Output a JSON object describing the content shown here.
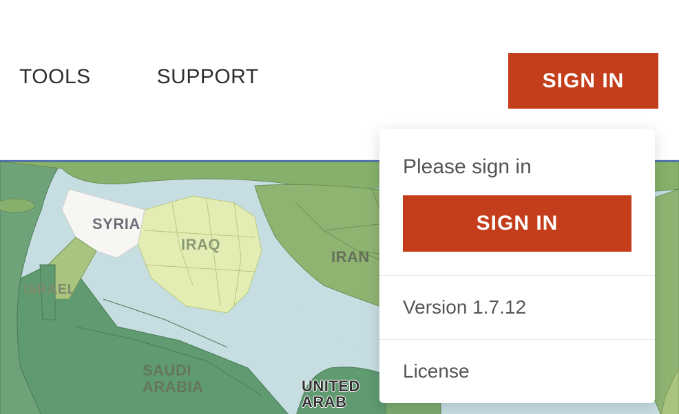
{
  "header": {
    "nav": {
      "tools": "TOOLS",
      "support": "SUPPORT"
    },
    "signin_button": "SIGN IN"
  },
  "dropdown": {
    "prompt": "Please sign in",
    "signin_button": "SIGN IN",
    "version_text": "Version 1.7.12",
    "license_text": "License"
  },
  "map": {
    "labels": {
      "syria": "SYRIA",
      "iraq": "IRAQ",
      "iran": "IRAN",
      "israel": "ISRAEL",
      "saudi": "SAUDI\nARABIA",
      "uae": "UNITED\nARAB"
    }
  },
  "colors": {
    "accent": "#c43e1c",
    "water": "#c6dde2",
    "land_light": "#dbe7a3",
    "land_med": "#a8c47e",
    "land_dark": "#5f9a71",
    "syria_fill": "#f8f6f2"
  }
}
